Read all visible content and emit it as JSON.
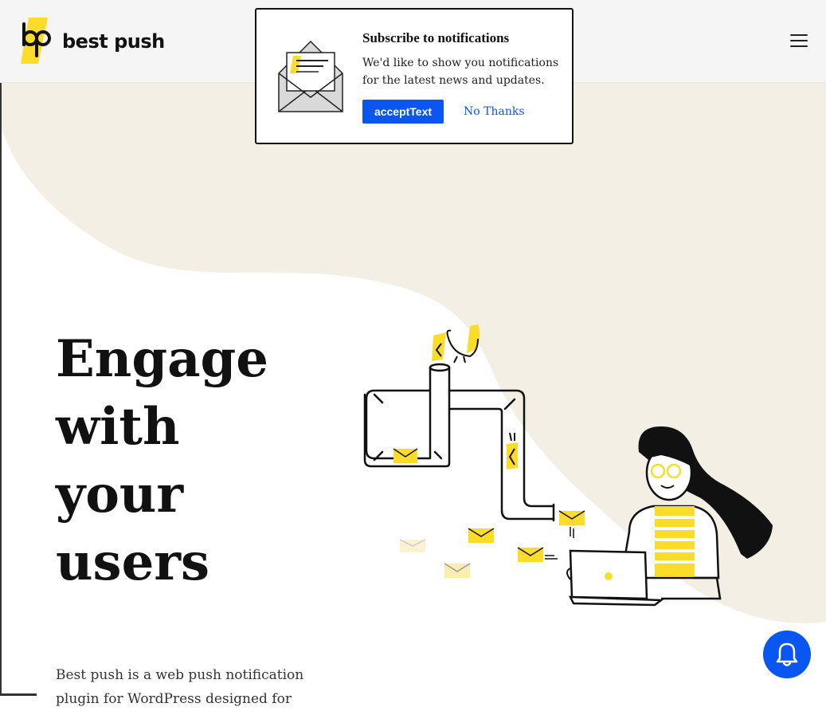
{
  "header": {
    "brand": "best push",
    "menu_icon": "hamburger-menu-icon"
  },
  "popup": {
    "title": "Subscribe to notifications",
    "body": "We'd like to show you notifications for the latest news and updates.",
    "accept_label": "acceptText",
    "decline_label": "No Thanks",
    "icon": "envelope-letter-icon"
  },
  "hero": {
    "title_lines": [
      "Engage",
      "with",
      "your",
      "users"
    ],
    "description": "Best push is a web push notification plugin for WordPress designed for"
  },
  "bell": {
    "icon": "bell-icon"
  },
  "colors": {
    "accent": "#0a56f0",
    "brand_yellow": "#fcdc2a",
    "cream": "#f3efe4",
    "header_bg": "#f5f5f5"
  }
}
